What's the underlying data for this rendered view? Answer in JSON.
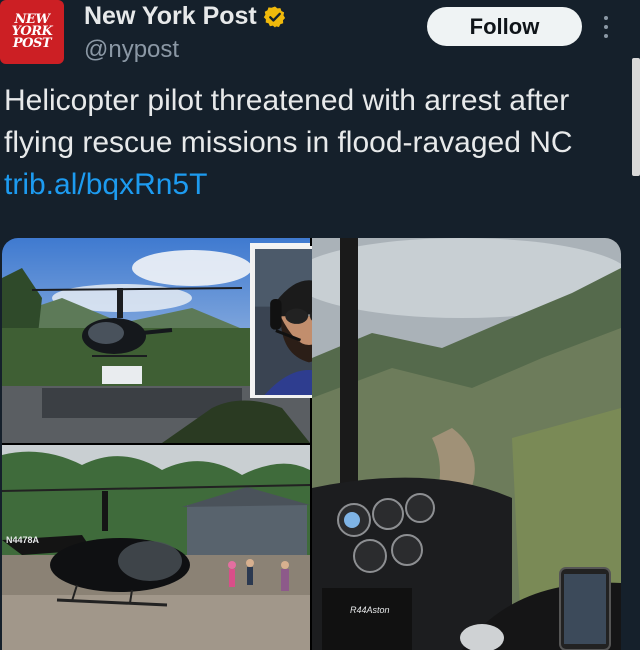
{
  "account": {
    "avatar_text": [
      "NEW",
      "YORK",
      "POST"
    ],
    "name": "New York Post",
    "handle": "@nypost",
    "verified_icon": "verified-badge-icon"
  },
  "actions": {
    "follow_label": "Follow",
    "more_icon": "more-vertical-icon"
  },
  "tweet": {
    "text": "Helicopter pilot threatened with arrest after flying rescue missions in flood-ravaged NC ",
    "link": "trib.al/bqxRn5T"
  },
  "media": {
    "images": [
      {
        "name": "helicopter-on-driveway-photo"
      },
      {
        "name": "pilot-portrait-inset-photo"
      },
      {
        "name": "helicopter-on-gravel-photo"
      },
      {
        "name": "cockpit-view-over-flooded-valley-photo"
      }
    ],
    "tail_number": "N4478A",
    "cockpit_label": "R44Aston"
  },
  "colors": {
    "background": "#15202b",
    "text": "#e7e9ea",
    "muted": "#8b98a5",
    "link": "#1d9bf0",
    "verified": "#f0b90b",
    "brand_red": "#cc1f24"
  }
}
